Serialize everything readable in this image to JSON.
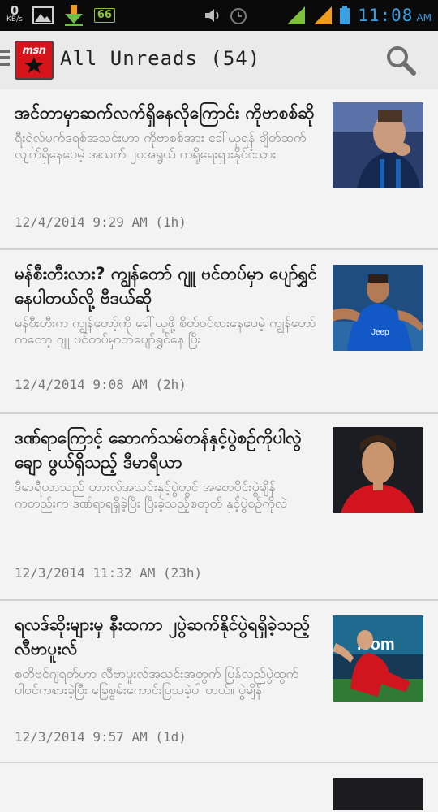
{
  "status_bar": {
    "speed_value": "0",
    "speed_unit": "KB/s",
    "badge": "66",
    "time": "11:08",
    "ampm": "AM"
  },
  "header": {
    "logo_text": "msn",
    "title": "All Unreads (54)"
  },
  "articles": [
    {
      "headline": "အင်တာမှာဆက်လက်ရှိနေလိုကြောင်း ကိုဗာစစ်ဆို",
      "summary": "ရီးရဲလ်မက်ဒရစ်အသင်းဟာ ကိုဗာစစ်အား ခေါ်ယူရန် ချိတ်ဆက်လျက်ရှိနေပေမဲ့ အသက် ၂၀အရွယ် ကရိုရေးရှားနိုင်ငံသား",
      "date": "12/4/2014 9:29 AM (1h)"
    },
    {
      "headline": "မန်စီးတီးလား? ကျွန်တော် ဂျူ ဗင်တပ်မှာ ပျော်ရွှင်နေပါတယ်လို့ ဗီဒယ်ဆို",
      "summary": "မန်စီးတီးက ကျွန်တော့်ကို ခေါ်ယူဖို့ စိတ်ဝင်စားနေပေမဲ့ ကျွန်တော်ကတော့ ဂျူ ဗင်တပ်မှာဘဲပျော်ရွှင်နေ ပြီး",
      "date": "12/4/2014 9:08 AM (2h)"
    },
    {
      "headline": "ဒဏ်ရာကြောင့် ဆောက်သမ်တန်နှင့်ပွဲစဉ်ကိုပါလွဲချော ဖွယ်ရှိသည့် ဒီမာရီယာ",
      "summary": "ဒီမာရီယာသည် ဟားလ်အသင်းနှင့်ပွဲတွင် အစောပိုင်းပွဲချိန်ကတည်းက ဒဏ်ရာရရှိခဲ့ပြီး ပြီးခဲ့သည့်စတုတ် နှင့်ပွဲစဉ်ကိုလဲ",
      "date": "12/3/2014 11:32 AM (23h)"
    },
    {
      "headline": "ရလဒ်ဆိုးများမှ နီးထကာ ၂ပွဲဆက်နိုင်ပွဲရရှိခဲ့သည့် လီဗာပူးလ်",
      "summary": "စတိဗင်ဂျရတ်ဟာ လီဗာပူးလ်အသင်းအတွက် ပြန်လည်ပွဲထွက်ပါဝင်ကစားခဲ့ပြီး ခြေစွမ်းကောင်းပြသခဲ့ပါ တယ်။ ပွဲချိန်",
      "date": "12/3/2014 9:57 AM (1d)"
    },
    {
      "headline": "",
      "summary": "",
      "date": ""
    }
  ],
  "icons": {
    "menu": "menu-icon",
    "search": "search-icon"
  },
  "colors": {
    "status_blue": "#3aa0e6",
    "logo_red": "#d7141b",
    "signal_green": "#7ec13a",
    "signal_orange": "#f09a1e"
  }
}
